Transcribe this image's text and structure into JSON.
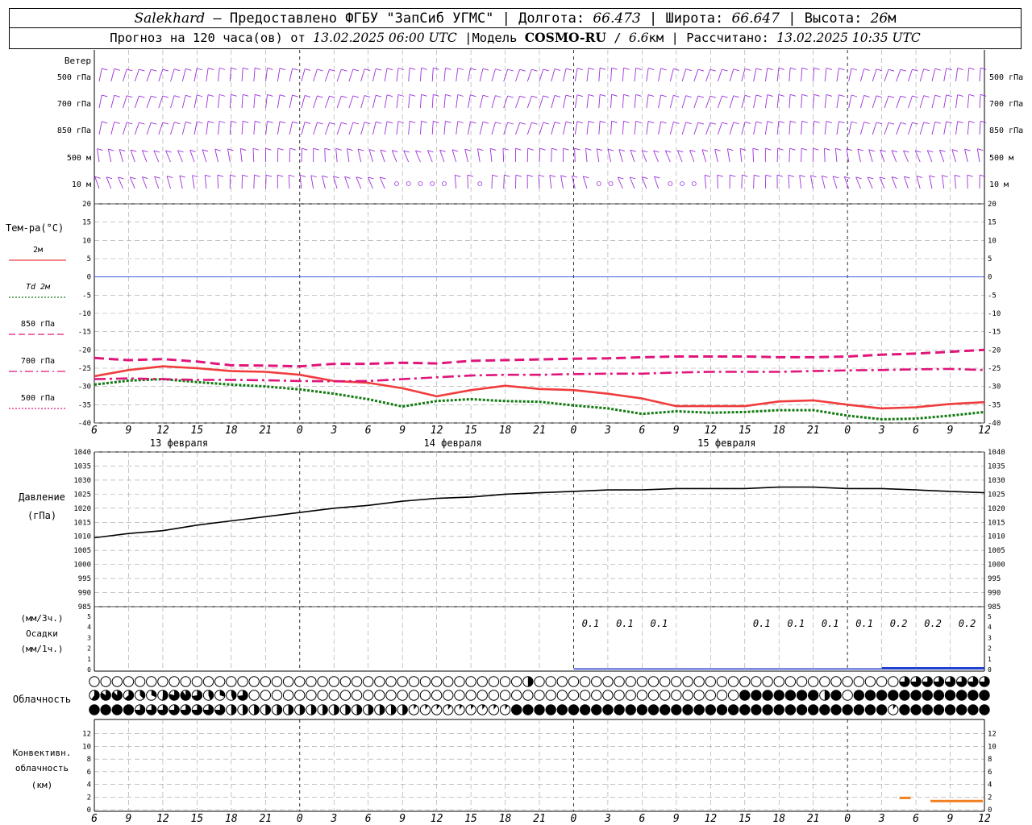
{
  "header": {
    "station": "Salekhard",
    "dash": " – ",
    "provider": "Предоставлено ФГБУ \"ЗапСиб УГМС\"",
    "lon_label": "Долгота:",
    "lon": "66.473",
    "lat_label": "Широта:",
    "lat": "66.647",
    "alt_label": "Высота:",
    "alt": "26",
    "alt_unit": "м",
    "forecast_label": "Прогноз на 120 часа(ов) от",
    "start": "13.02.2025 06:00 UTC",
    "model_label": "Модель",
    "model": "COSMO-RU",
    "resolution": "6.6",
    "res_unit": "км",
    "calc_label": "Рассчитано:",
    "calc": "13.02.2025 10:35 UTC",
    "sep": "|"
  },
  "colors": {
    "wind": "#9b30d9",
    "t2m": "#f03c3c",
    "td2m": "#117a11",
    "t850": "#e0147a",
    "t700": "#e0147a",
    "t500": "#e0147a",
    "zero": "#3050e0",
    "pressure": "#000000",
    "precip": "#2040d0",
    "convective": "#f08020",
    "grid": "#a0a0a0"
  },
  "wind_panel": {
    "title": "Ветер",
    "levels": [
      "500 гПа",
      "700 гПа",
      "850 гПа",
      "500 м",
      "10 м"
    ]
  },
  "temp_panel": {
    "title": "Тем-ра(°С)",
    "ylim": [
      -40,
      20
    ],
    "ticks": [
      20,
      15,
      10,
      5,
      0,
      -5,
      -10,
      -15,
      -20,
      -25,
      -30,
      -35,
      -40
    ],
    "legend": [
      {
        "label": "2м",
        "style": "solid",
        "color_key": "t2m"
      },
      {
        "label": "Td  2м",
        "style": "dotted",
        "color_key": "td2m"
      },
      {
        "label": "850 гПа",
        "style": "dashed",
        "color_key": "t850"
      },
      {
        "label": "700 гПа",
        "style": "dashdot",
        "color_key": "t700"
      },
      {
        "label": "500 гПа",
        "style": "dotted",
        "color_key": "t500"
      }
    ]
  },
  "time_axis": {
    "hours": [
      6,
      9,
      12,
      15,
      18,
      21,
      0,
      3,
      6,
      9,
      12,
      15,
      18,
      21,
      0,
      3,
      6,
      9,
      12,
      15,
      18,
      21,
      0,
      3,
      6,
      9,
      12
    ],
    "day_labels": [
      "13 февраля",
      "14 февраля",
      "15 февраля"
    ],
    "day_label_at_index": [
      2,
      10,
      18
    ],
    "midnight_index": [
      6,
      14,
      22
    ]
  },
  "pressure_panel": {
    "title": "Давление",
    "unit": "(гПа)",
    "ylim": [
      985,
      1040
    ],
    "ticks": [
      1040,
      1035,
      1030,
      1025,
      1020,
      1015,
      1010,
      1005,
      1000,
      995,
      990,
      985
    ]
  },
  "precip_panel": {
    "unit3": "(мм/3ч.)",
    "title": "Осадки",
    "unit1": "(мм/1ч.)",
    "ylim": [
      0,
      5
    ],
    "ticks": [
      5,
      4,
      3,
      2,
      1,
      0
    ],
    "labels": [
      {
        "index": 14,
        "text": "0.1"
      },
      {
        "index": 15,
        "text": "0.1"
      },
      {
        "index": 16,
        "text": "0.1"
      },
      {
        "index": 19,
        "text": "0.1"
      },
      {
        "index": 20,
        "text": "0.1"
      },
      {
        "index": 21,
        "text": "0.1"
      },
      {
        "index": 22,
        "text": "0.1"
      },
      {
        "index": 23,
        "text": "0.2"
      },
      {
        "index": 24,
        "text": "0.2"
      },
      {
        "index": 25,
        "text": "0.2"
      }
    ]
  },
  "cloud_panel": {
    "title": "Облачность"
  },
  "conv_panel": {
    "title1": "Конвективн.",
    "title2": "облачность",
    "unit": "(км)",
    "ylim": [
      0,
      14
    ],
    "ticks": [
      12,
      10,
      8,
      6,
      4,
      2,
      0
    ]
  },
  "chart_data": [
    {
      "type": "line",
      "title": "Тем-ра(°С)",
      "x_hours": [
        0,
        3,
        6,
        9,
        12,
        15,
        18,
        21,
        24,
        27,
        30,
        33,
        36,
        39,
        42,
        45,
        48,
        51,
        54,
        57,
        60,
        63,
        66,
        69,
        72,
        75,
        78
      ],
      "ylim": [
        -40,
        20
      ],
      "series": [
        {
          "name": "2м",
          "values": [
            -27.2,
            -25.5,
            -24.5,
            -25.0,
            -25.8,
            -26.0,
            -26.8,
            -28.5,
            -29.0,
            -30.5,
            -32.7,
            -31.0,
            -29.8,
            -30.7,
            -31.0,
            -32.0,
            -33.3,
            -35.4,
            -35.4,
            -35.4,
            -34.1,
            -33.8,
            -35.0,
            -36.0,
            -35.7,
            -34.8,
            -34.3
          ]
        },
        {
          "name": "Td  2м",
          "values": [
            -29.5,
            -28.4,
            -28.0,
            -28.8,
            -29.5,
            -30.0,
            -30.8,
            -32.0,
            -33.5,
            -35.5,
            -34.0,
            -33.5,
            -34.0,
            -34.2,
            -35.2,
            -36.0,
            -37.5,
            -36.8,
            -37.2,
            -37.0,
            -36.5,
            -36.5,
            -38.0,
            -39.0,
            -38.8,
            -38.0,
            -37.0
          ]
        },
        {
          "name": "850 гПа",
          "values": [
            -22.2,
            -22.8,
            -22.5,
            -23.2,
            -24.2,
            -24.3,
            -24.5,
            -23.8,
            -23.8,
            -23.5,
            -23.7,
            -23.0,
            -22.8,
            -22.6,
            -22.4,
            -22.3,
            -22.0,
            -21.8,
            -21.8,
            -21.8,
            -22.0,
            -22.0,
            -21.8,
            -21.3,
            -21.0,
            -20.5,
            -20.0
          ]
        },
        {
          "name": "700 гПа",
          "values": [
            -28.0,
            -27.8,
            -28.0,
            -28.2,
            -28.2,
            -28.3,
            -28.5,
            -28.6,
            -28.5,
            -28.0,
            -27.5,
            -27.0,
            -26.8,
            -26.8,
            -26.6,
            -26.5,
            -26.5,
            -26.2,
            -26.0,
            -26.0,
            -26.0,
            -25.8,
            -25.6,
            -25.5,
            -25.3,
            -25.2,
            -25.5
          ]
        }
      ]
    },
    {
      "type": "line",
      "title": "Давление",
      "x_hours": [
        0,
        3,
        6,
        9,
        12,
        15,
        18,
        21,
        24,
        27,
        30,
        33,
        36,
        39,
        42,
        45,
        48,
        51,
        54,
        57,
        60,
        63,
        66,
        69,
        72,
        75,
        78
      ],
      "ylim": [
        985,
        1040
      ],
      "series": [
        {
          "name": "Давление",
          "values": [
            1009.5,
            1011.0,
            1012.0,
            1014.0,
            1015.5,
            1017.0,
            1018.5,
            1020.0,
            1021.0,
            1022.5,
            1023.5,
            1024.0,
            1025.0,
            1025.5,
            1026.0,
            1026.5,
            1026.5,
            1027.0,
            1027.0,
            1027.0,
            1027.5,
            1027.5,
            1027.0,
            1027.0,
            1026.5,
            1026.0,
            1025.5
          ]
        }
      ]
    }
  ]
}
